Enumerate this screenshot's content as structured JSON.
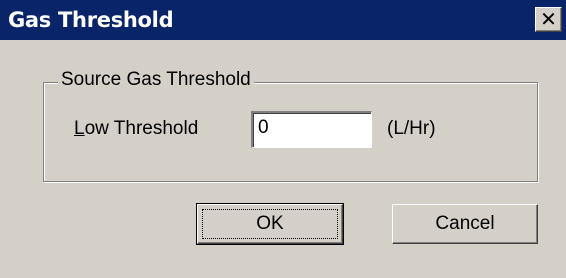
{
  "window": {
    "title": "Gas Threshold",
    "close_glyph": "✕"
  },
  "group": {
    "legend": "Source Gas Threshold",
    "field_label_mnemonic": "L",
    "field_label_rest": "ow Threshold",
    "field_value": "0",
    "unit": "(L/Hr)"
  },
  "buttons": {
    "ok": "OK",
    "cancel": "Cancel"
  },
  "colors": {
    "titlebar": "#0a246a",
    "face": "#d4d0c8"
  }
}
